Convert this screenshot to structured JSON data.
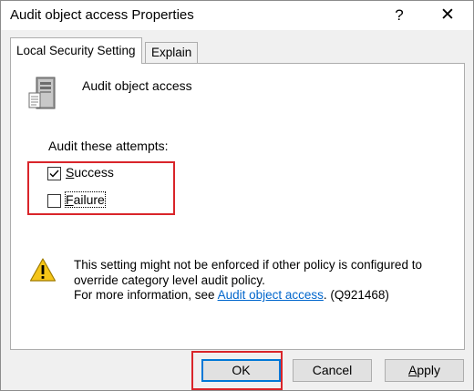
{
  "window": {
    "title": "Audit object access Properties",
    "help_glyph": "?",
    "close_glyph": "✕"
  },
  "tabs": [
    {
      "label": "Local Security Setting",
      "selected": true
    },
    {
      "label": "Explain",
      "selected": false
    }
  ],
  "policy": {
    "icon": "server-icon",
    "name": "Audit object access"
  },
  "audit": {
    "label": "Audit these attempts:",
    "success": {
      "label_underlined": "S",
      "label_rest": "uccess",
      "checked": true
    },
    "failure": {
      "label_underlined": "F",
      "label_rest": "ailure",
      "checked": false
    }
  },
  "warning": {
    "icon": "warning-icon",
    "line1": "This setting might not be enforced if other policy is configured to",
    "line2": "override category level audit policy.",
    "line3_prefix": "For more information, see ",
    "link_text": "Audit object access",
    "line3_suffix": ". (Q921468)"
  },
  "buttons": {
    "ok": "OK",
    "cancel": "Cancel",
    "apply_underlined": "A",
    "apply_rest": "pply"
  },
  "colors": {
    "highlight_box": "#d9252a",
    "link": "#0066cc",
    "focus_border": "#0078d7"
  }
}
